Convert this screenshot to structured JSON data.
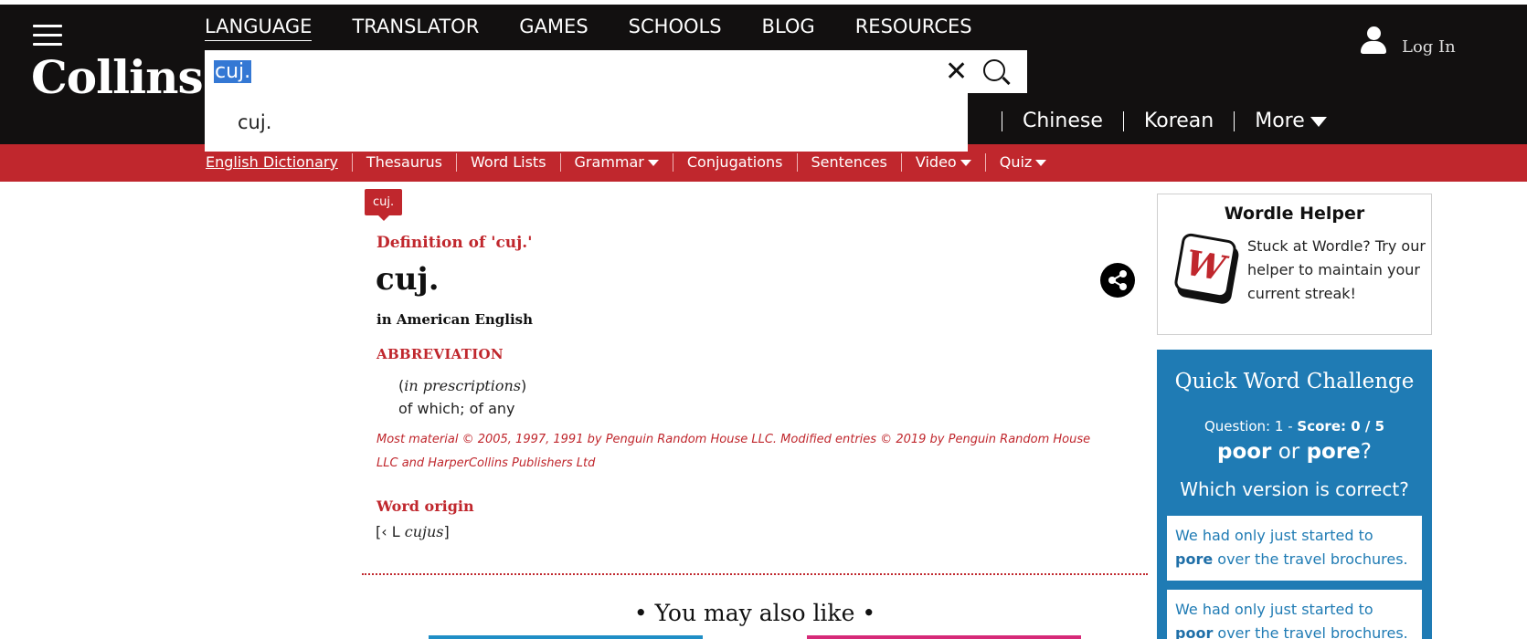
{
  "brand": {
    "logo_text": "Collins"
  },
  "top_nav": [
    "LANGUAGE",
    "TRANSLATOR",
    "GAMES",
    "SCHOOLS",
    "BLOG",
    "RESOURCES"
  ],
  "account": {
    "login_label": "Log In"
  },
  "search": {
    "value": "cuj.",
    "clear_icon": "close-icon",
    "search_icon": "search-icon",
    "suggestions": [
      "cuj."
    ]
  },
  "languages": {
    "items": [
      "Chinese",
      "Korean"
    ],
    "more_label": "More"
  },
  "sub_nav": {
    "items": [
      "English Dictionary",
      "Thesaurus",
      "Word Lists",
      "Grammar",
      "Conjugations",
      "Sentences",
      "Video",
      "Quiz"
    ],
    "active": "English Dictionary"
  },
  "entry": {
    "tag": "cuj.",
    "definition_heading": "Definition of  'cuj.'",
    "headword": "cuj.",
    "variety": "in American English",
    "part_of_speech": "ABBREVIATION",
    "sense_label_open": "(",
    "sense_label": "in prescriptions",
    "sense_label_close": ")",
    "sense_text": "of which; of any",
    "copyright": "Most material © 2005, 1997, 1991 by Penguin Random House LLC. Modified entries © 2019 by Penguin Random House LLC and HarperCollins Publishers Ltd",
    "origin_heading": "Word origin",
    "origin_prefix": "[‹ L ",
    "origin_word": "cujus",
    "origin_suffix": "]"
  },
  "also_like": {
    "heading": "• You may also like •"
  },
  "wordle_helper": {
    "title": "Wordle Helper",
    "tile_letter": "W",
    "text": "Stuck at Wordle? Try our helper to maintain your current streak!"
  },
  "quiz": {
    "title": "Quick Word Challenge",
    "question_label": "Question: 1",
    "dash": "-",
    "score_label": "Score: 0 / 5",
    "word_a": "poor",
    "or_word": "or",
    "word_b": "pore",
    "question_mark": "?",
    "prompt": "Which version is correct?",
    "option1_pre": "We had only just started to ",
    "option1_word": "pore",
    "option1_post": " over the travel brochures.",
    "option2_pre": "We had only just started to ",
    "option2_word": "poor",
    "option2_post": " over the travel brochures."
  },
  "colors": {
    "header_bg": "#121010",
    "brand_red": "#c0272d",
    "quiz_blue": "#1f7bb4"
  }
}
